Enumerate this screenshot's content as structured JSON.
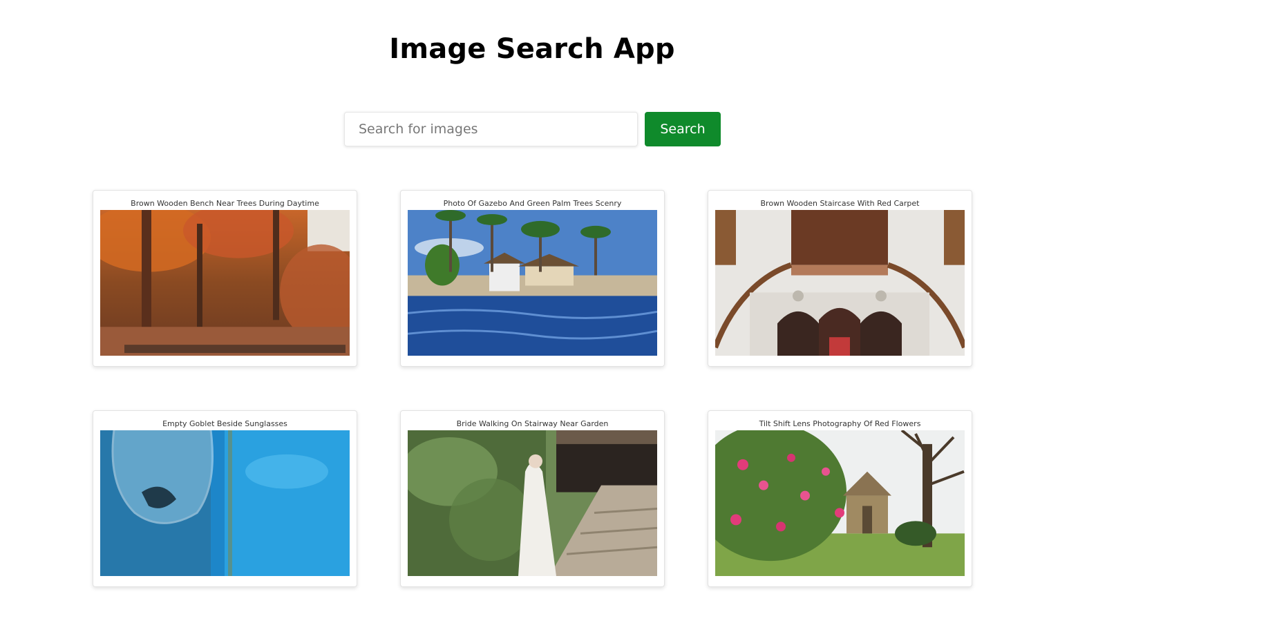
{
  "header": {
    "title": "Image Search App"
  },
  "search": {
    "placeholder": "Search for images",
    "value": "",
    "button_label": "Search"
  },
  "results": [
    {
      "caption": "Brown Wooden Bench Near Trees During Daytime"
    },
    {
      "caption": "Photo Of Gazebo And Green Palm Trees Scenry"
    },
    {
      "caption": "Brown Wooden Staircase With Red Carpet"
    },
    {
      "caption": "Empty Goblet Beside Sunglasses"
    },
    {
      "caption": "Bride Walking On Stairway Near Garden"
    },
    {
      "caption": "Tilt Shift Lens Photography Of Red Flowers"
    }
  ],
  "colors": {
    "accent": "#0f8a2b",
    "background": "#ffffff"
  }
}
